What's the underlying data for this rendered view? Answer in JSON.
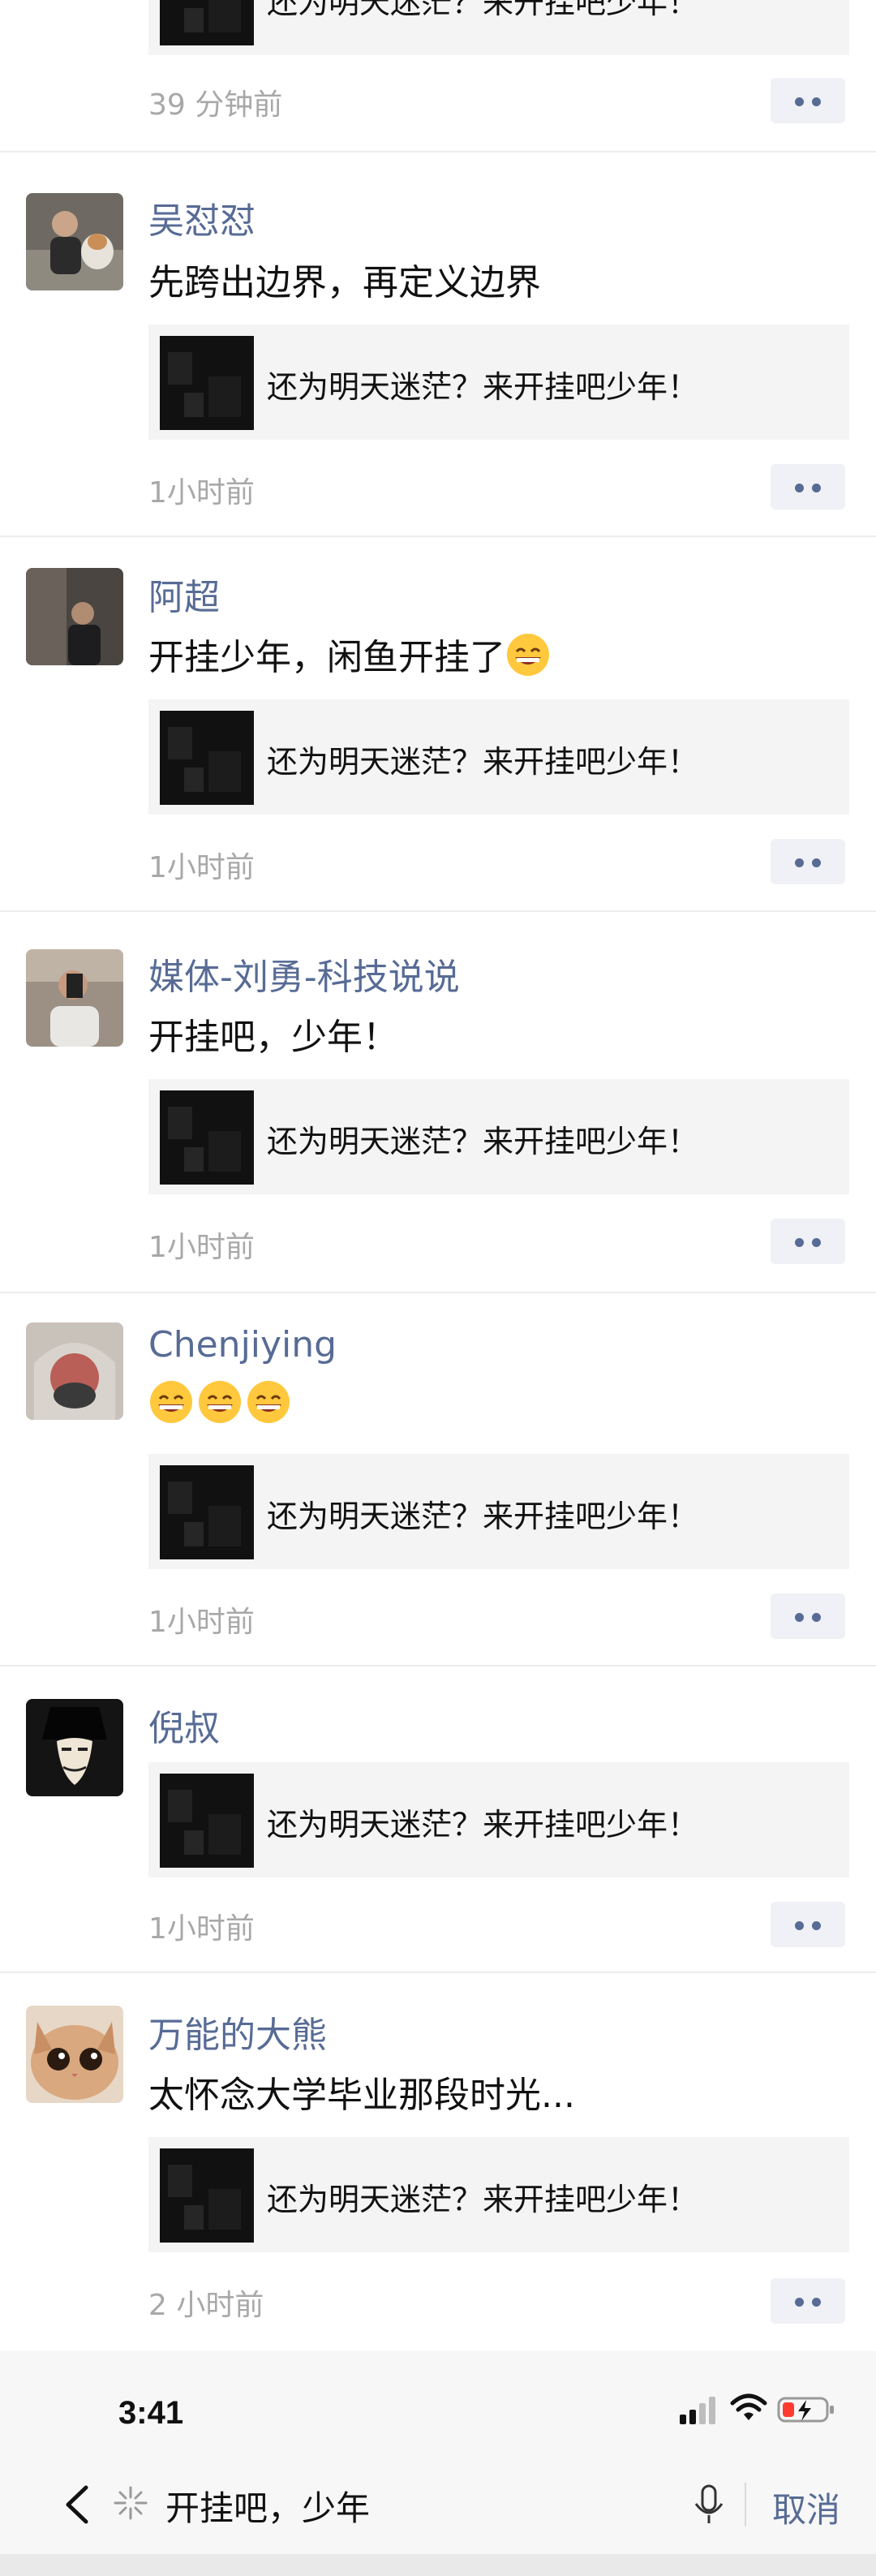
{
  "posts": [
    {
      "name": "",
      "text": "",
      "link": "还为明天迷茫？来开挂吧少年！",
      "time": "39 分钟前"
    },
    {
      "name": "吴怼怼",
      "text": "先跨出边界，再定义边界",
      "link": "还为明天迷茫？来开挂吧少年！",
      "time": "1小时前"
    },
    {
      "name": "阿超",
      "text": "开挂少年，闲鱼开挂了",
      "link": "还为明天迷茫？来开挂吧少年！",
      "time": "1小时前"
    },
    {
      "name": "媒体-刘勇-科技说说",
      "text": "开挂吧，少年！",
      "link": "还为明天迷茫？来开挂吧少年！",
      "time": "1小时前"
    },
    {
      "name": "Chenjiying",
      "text": "",
      "link": "还为明天迷茫？来开挂吧少年！",
      "time": "1小时前"
    },
    {
      "name": "倪叔",
      "text": "",
      "link": "还为明天迷茫？来开挂吧少年！",
      "time": "1小时前"
    },
    {
      "name": "万能的大熊",
      "text": "太怀念大学毕业那段时光...",
      "link": "还为明天迷茫？来开挂吧少年！",
      "time": "2 小时前"
    }
  ],
  "status_bar": {
    "time": "3:41"
  },
  "search": {
    "query": "开挂吧，少年",
    "cancel_label": "取消"
  },
  "colors": {
    "name_link": "#576b95",
    "time_gray": "#a8a8a8",
    "card_bg": "#f4f4f4"
  },
  "icons": [
    "back-chevron-icon",
    "sparkle-icon",
    "microphone-icon",
    "signal-icon",
    "wifi-icon",
    "battery-charging-icon",
    "more-dots-icon",
    "grin-emoji-icon"
  ]
}
